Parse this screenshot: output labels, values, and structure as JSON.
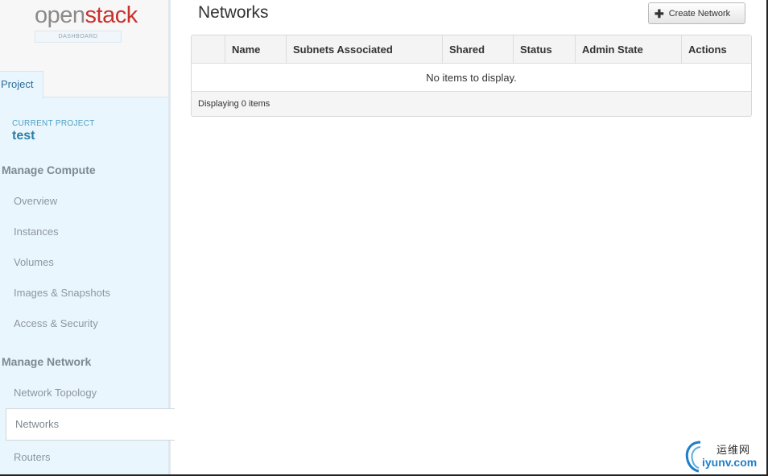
{
  "logo": {
    "open": "open",
    "stack": "stack",
    "sub": "DASHBOARD"
  },
  "sidebar": {
    "tab": "Project",
    "current_project_label": "CURRENT PROJECT",
    "current_project_name": "test",
    "sections": [
      {
        "title": "Manage Compute",
        "items": [
          "Overview",
          "Instances",
          "Volumes",
          "Images & Snapshots",
          "Access & Security"
        ]
      },
      {
        "title": "Manage Network",
        "items": [
          "Network Topology",
          "Networks",
          "Routers"
        ]
      }
    ],
    "active_item": "Networks"
  },
  "page": {
    "title": "Networks",
    "create_button": "Create Network",
    "columns": [
      "",
      "Name",
      "Subnets Associated",
      "Shared",
      "Status",
      "Admin State",
      "Actions"
    ],
    "empty_message": "No items to display.",
    "footer": "Displaying 0 items"
  },
  "watermark": {
    "cn": "运维网",
    "en": "iyunv.com"
  }
}
